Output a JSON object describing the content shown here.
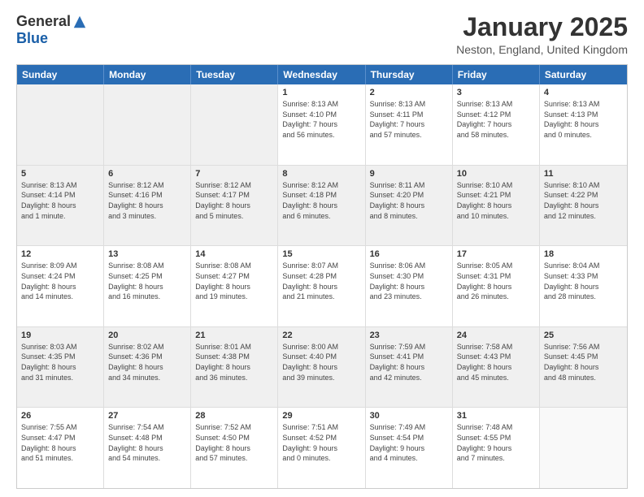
{
  "logo": {
    "general": "General",
    "blue": "Blue"
  },
  "title": "January 2025",
  "location": "Neston, England, United Kingdom",
  "weekdays": [
    "Sunday",
    "Monday",
    "Tuesday",
    "Wednesday",
    "Thursday",
    "Friday",
    "Saturday"
  ],
  "rows": [
    [
      {
        "day": "",
        "lines": [],
        "shaded": true
      },
      {
        "day": "",
        "lines": [],
        "shaded": true
      },
      {
        "day": "",
        "lines": [],
        "shaded": true
      },
      {
        "day": "1",
        "lines": [
          "Sunrise: 8:13 AM",
          "Sunset: 4:10 PM",
          "Daylight: 7 hours",
          "and 56 minutes."
        ]
      },
      {
        "day": "2",
        "lines": [
          "Sunrise: 8:13 AM",
          "Sunset: 4:11 PM",
          "Daylight: 7 hours",
          "and 57 minutes."
        ]
      },
      {
        "day": "3",
        "lines": [
          "Sunrise: 8:13 AM",
          "Sunset: 4:12 PM",
          "Daylight: 7 hours",
          "and 58 minutes."
        ]
      },
      {
        "day": "4",
        "lines": [
          "Sunrise: 8:13 AM",
          "Sunset: 4:13 PM",
          "Daylight: 8 hours",
          "and 0 minutes."
        ]
      }
    ],
    [
      {
        "day": "5",
        "lines": [
          "Sunrise: 8:13 AM",
          "Sunset: 4:14 PM",
          "Daylight: 8 hours",
          "and 1 minute."
        ],
        "shaded": true
      },
      {
        "day": "6",
        "lines": [
          "Sunrise: 8:12 AM",
          "Sunset: 4:16 PM",
          "Daylight: 8 hours",
          "and 3 minutes."
        ],
        "shaded": true
      },
      {
        "day": "7",
        "lines": [
          "Sunrise: 8:12 AM",
          "Sunset: 4:17 PM",
          "Daylight: 8 hours",
          "and 5 minutes."
        ],
        "shaded": true
      },
      {
        "day": "8",
        "lines": [
          "Sunrise: 8:12 AM",
          "Sunset: 4:18 PM",
          "Daylight: 8 hours",
          "and 6 minutes."
        ],
        "shaded": true
      },
      {
        "day": "9",
        "lines": [
          "Sunrise: 8:11 AM",
          "Sunset: 4:20 PM",
          "Daylight: 8 hours",
          "and 8 minutes."
        ],
        "shaded": true
      },
      {
        "day": "10",
        "lines": [
          "Sunrise: 8:10 AM",
          "Sunset: 4:21 PM",
          "Daylight: 8 hours",
          "and 10 minutes."
        ],
        "shaded": true
      },
      {
        "day": "11",
        "lines": [
          "Sunrise: 8:10 AM",
          "Sunset: 4:22 PM",
          "Daylight: 8 hours",
          "and 12 minutes."
        ],
        "shaded": true
      }
    ],
    [
      {
        "day": "12",
        "lines": [
          "Sunrise: 8:09 AM",
          "Sunset: 4:24 PM",
          "Daylight: 8 hours",
          "and 14 minutes."
        ]
      },
      {
        "day": "13",
        "lines": [
          "Sunrise: 8:08 AM",
          "Sunset: 4:25 PM",
          "Daylight: 8 hours",
          "and 16 minutes."
        ]
      },
      {
        "day": "14",
        "lines": [
          "Sunrise: 8:08 AM",
          "Sunset: 4:27 PM",
          "Daylight: 8 hours",
          "and 19 minutes."
        ]
      },
      {
        "day": "15",
        "lines": [
          "Sunrise: 8:07 AM",
          "Sunset: 4:28 PM",
          "Daylight: 8 hours",
          "and 21 minutes."
        ]
      },
      {
        "day": "16",
        "lines": [
          "Sunrise: 8:06 AM",
          "Sunset: 4:30 PM",
          "Daylight: 8 hours",
          "and 23 minutes."
        ]
      },
      {
        "day": "17",
        "lines": [
          "Sunrise: 8:05 AM",
          "Sunset: 4:31 PM",
          "Daylight: 8 hours",
          "and 26 minutes."
        ]
      },
      {
        "day": "18",
        "lines": [
          "Sunrise: 8:04 AM",
          "Sunset: 4:33 PM",
          "Daylight: 8 hours",
          "and 28 minutes."
        ]
      }
    ],
    [
      {
        "day": "19",
        "lines": [
          "Sunrise: 8:03 AM",
          "Sunset: 4:35 PM",
          "Daylight: 8 hours",
          "and 31 minutes."
        ],
        "shaded": true
      },
      {
        "day": "20",
        "lines": [
          "Sunrise: 8:02 AM",
          "Sunset: 4:36 PM",
          "Daylight: 8 hours",
          "and 34 minutes."
        ],
        "shaded": true
      },
      {
        "day": "21",
        "lines": [
          "Sunrise: 8:01 AM",
          "Sunset: 4:38 PM",
          "Daylight: 8 hours",
          "and 36 minutes."
        ],
        "shaded": true
      },
      {
        "day": "22",
        "lines": [
          "Sunrise: 8:00 AM",
          "Sunset: 4:40 PM",
          "Daylight: 8 hours",
          "and 39 minutes."
        ],
        "shaded": true
      },
      {
        "day": "23",
        "lines": [
          "Sunrise: 7:59 AM",
          "Sunset: 4:41 PM",
          "Daylight: 8 hours",
          "and 42 minutes."
        ],
        "shaded": true
      },
      {
        "day": "24",
        "lines": [
          "Sunrise: 7:58 AM",
          "Sunset: 4:43 PM",
          "Daylight: 8 hours",
          "and 45 minutes."
        ],
        "shaded": true
      },
      {
        "day": "25",
        "lines": [
          "Sunrise: 7:56 AM",
          "Sunset: 4:45 PM",
          "Daylight: 8 hours",
          "and 48 minutes."
        ],
        "shaded": true
      }
    ],
    [
      {
        "day": "26",
        "lines": [
          "Sunrise: 7:55 AM",
          "Sunset: 4:47 PM",
          "Daylight: 8 hours",
          "and 51 minutes."
        ]
      },
      {
        "day": "27",
        "lines": [
          "Sunrise: 7:54 AM",
          "Sunset: 4:48 PM",
          "Daylight: 8 hours",
          "and 54 minutes."
        ]
      },
      {
        "day": "28",
        "lines": [
          "Sunrise: 7:52 AM",
          "Sunset: 4:50 PM",
          "Daylight: 8 hours",
          "and 57 minutes."
        ]
      },
      {
        "day": "29",
        "lines": [
          "Sunrise: 7:51 AM",
          "Sunset: 4:52 PM",
          "Daylight: 9 hours",
          "and 0 minutes."
        ]
      },
      {
        "day": "30",
        "lines": [
          "Sunrise: 7:49 AM",
          "Sunset: 4:54 PM",
          "Daylight: 9 hours",
          "and 4 minutes."
        ]
      },
      {
        "day": "31",
        "lines": [
          "Sunrise: 7:48 AM",
          "Sunset: 4:55 PM",
          "Daylight: 9 hours",
          "and 7 minutes."
        ]
      },
      {
        "day": "",
        "lines": [],
        "empty": true
      }
    ]
  ]
}
